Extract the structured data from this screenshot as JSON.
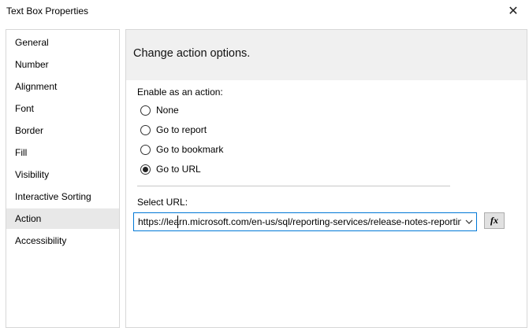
{
  "window": {
    "title": "Text Box Properties",
    "close_glyph": "✕"
  },
  "sidebar": {
    "items": [
      {
        "label": "General"
      },
      {
        "label": "Number"
      },
      {
        "label": "Alignment"
      },
      {
        "label": "Font"
      },
      {
        "label": "Border"
      },
      {
        "label": "Fill"
      },
      {
        "label": "Visibility"
      },
      {
        "label": "Interactive Sorting"
      },
      {
        "label": "Action"
      },
      {
        "label": "Accessibility"
      }
    ],
    "selected": "Action"
  },
  "content": {
    "header": "Change action options.",
    "enable_label": "Enable as an action:",
    "options": [
      {
        "label": "None",
        "checked": false
      },
      {
        "label": "Go to report",
        "checked": false
      },
      {
        "label": "Go to bookmark",
        "checked": false
      },
      {
        "label": "Go to URL",
        "checked": true
      }
    ],
    "select_url_label": "Select URL:",
    "url_value": "https://learn.microsoft.com/en-us/sql/reporting-services/release-notes-reporting-services",
    "fx_label": "fx"
  },
  "colors": {
    "selected_bg": "#e8e8e8",
    "header_bg": "#f0f0f0",
    "focus_border": "#0078d7"
  },
  "icons": {
    "close": "close-icon",
    "dropdown": "chevron-down-icon",
    "expression": "fx-icon"
  }
}
